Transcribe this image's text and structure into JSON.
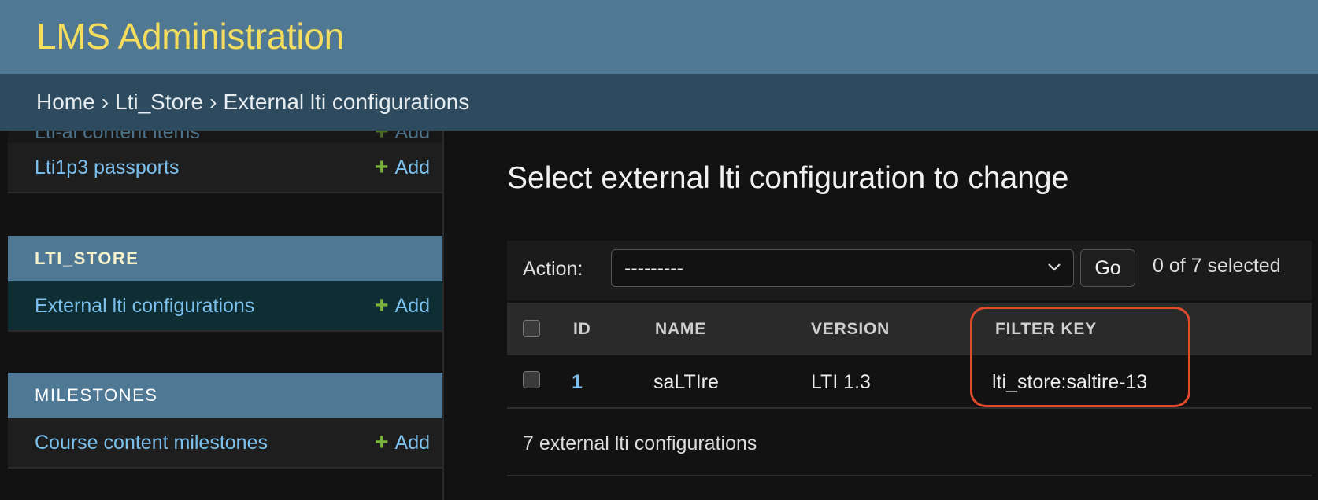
{
  "header": {
    "site_title": "LMS Administration"
  },
  "breadcrumbs": {
    "home": "Home",
    "app": "Lti_Store",
    "current": "External lti configurations",
    "separator": "›"
  },
  "sidebar": {
    "cut_row": {
      "label": "Lti-ai content items",
      "add": "Add"
    },
    "rows": [
      {
        "label": "Lti1p3 passports",
        "add": "Add"
      }
    ],
    "lti_store": {
      "caption": "LTI_STORE",
      "rows": [
        {
          "label": "External lti configurations",
          "add": "Add"
        }
      ]
    },
    "milestones": {
      "caption": "MILESTONES",
      "rows": [
        {
          "label": "Course content milestones",
          "add": "Add"
        }
      ]
    }
  },
  "main": {
    "title": "Select external lti configuration to change",
    "actions": {
      "label": "Action:",
      "selected_option": "---------",
      "go": "Go",
      "selection_count": "0 of 7 selected"
    },
    "table": {
      "headers": [
        "ID",
        "NAME",
        "VERSION",
        "FILTER KEY"
      ],
      "rows": [
        {
          "id": "1",
          "name": "saLTIre",
          "version": "LTI 1.3",
          "filter_key": "lti_store:saltire-13"
        }
      ]
    },
    "paginator": "7 external lti configurations"
  },
  "colors": {
    "header": "#4f7894",
    "breadcrumbs": "#2e4a5e",
    "title": "#f5dd5d",
    "link": "#7cc0ee",
    "add_plus": "#79b33a",
    "highlight": "#e04b2c"
  }
}
